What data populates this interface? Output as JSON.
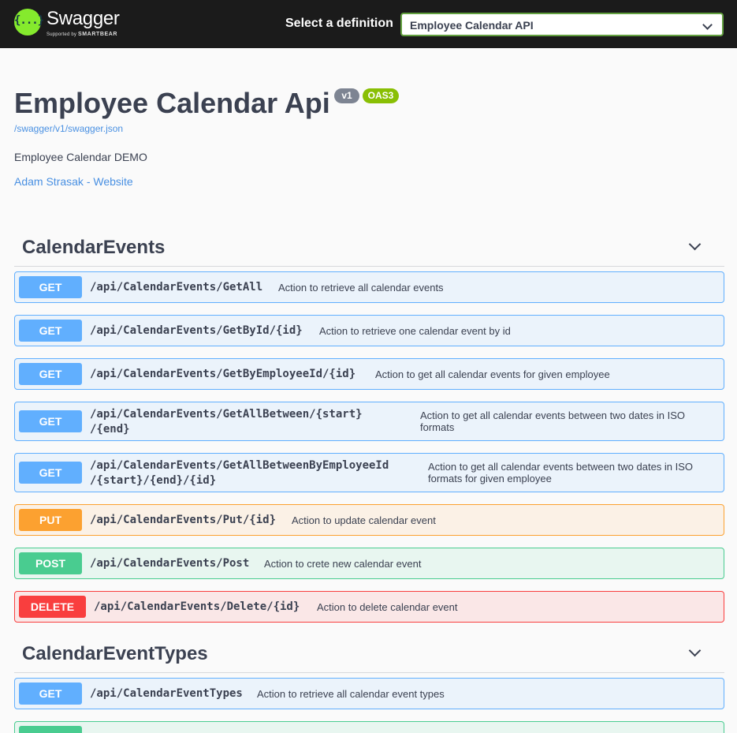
{
  "topbar": {
    "logo_title": "Swagger",
    "logo_sub_prefix": "Supported by",
    "logo_sub_brand": "SMARTBEAR",
    "logo_icon": "{...}",
    "definition_label": "Select a definition",
    "definition_value": "Employee Calendar API"
  },
  "info": {
    "title": "Employee Calendar Api",
    "version": "v1",
    "oas": "OAS3",
    "spec_url": "/swagger/v1/swagger.json",
    "description": "Employee Calendar DEMO",
    "contact": "Adam Strasak - Website"
  },
  "tags": [
    {
      "name": "CalendarEvents",
      "operations": [
        {
          "method": "GET",
          "path": "/api/CalendarEvents/GetAll",
          "summary": "Action to retrieve all calendar events"
        },
        {
          "method": "GET",
          "path": "/api/CalendarEvents/GetById/{id}",
          "summary": "Action to retrieve one calendar event by id"
        },
        {
          "method": "GET",
          "path": "/api/CalendarEvents/GetByEmployeeId/{id}",
          "summary": "Action to get all calendar events for given employee"
        },
        {
          "method": "GET",
          "path_line1": "/api/CalendarEvents/GetAllBetween/{start}",
          "path_line2": "/{end}",
          "summary_line1": "Action to get all calendar events between two dates in ISO",
          "summary_line2": "formats"
        },
        {
          "method": "GET",
          "path_line1": "/api/CalendarEvents/GetAllBetweenByEmployeeId",
          "path_line2": "/{start}/{end}/{id}",
          "summary_line1": "Action to get all calendar events between two dates in ISO",
          "summary_line2": "formats for given employee"
        },
        {
          "method": "PUT",
          "path": "/api/CalendarEvents/Put/{id}",
          "summary": "Action to update calendar event"
        },
        {
          "method": "POST",
          "path": "/api/CalendarEvents/Post",
          "summary": "Action to crete new calendar event"
        },
        {
          "method": "DELETE",
          "path": "/api/CalendarEvents/Delete/{id}",
          "summary": "Action to delete calendar event"
        }
      ]
    },
    {
      "name": "CalendarEventTypes",
      "operations": [
        {
          "method": "GET",
          "path": "/api/CalendarEventTypes",
          "summary": "Action to retrieve all calendar event types"
        }
      ]
    }
  ],
  "colors": {
    "get": "#61affe",
    "put": "#fca130",
    "post": "#49cc90",
    "delete": "#f93e3e",
    "brand_green": "#85ea2d",
    "version_badge": "#7d8492",
    "oas_badge": "#89bf04",
    "link": "#4990e2"
  }
}
